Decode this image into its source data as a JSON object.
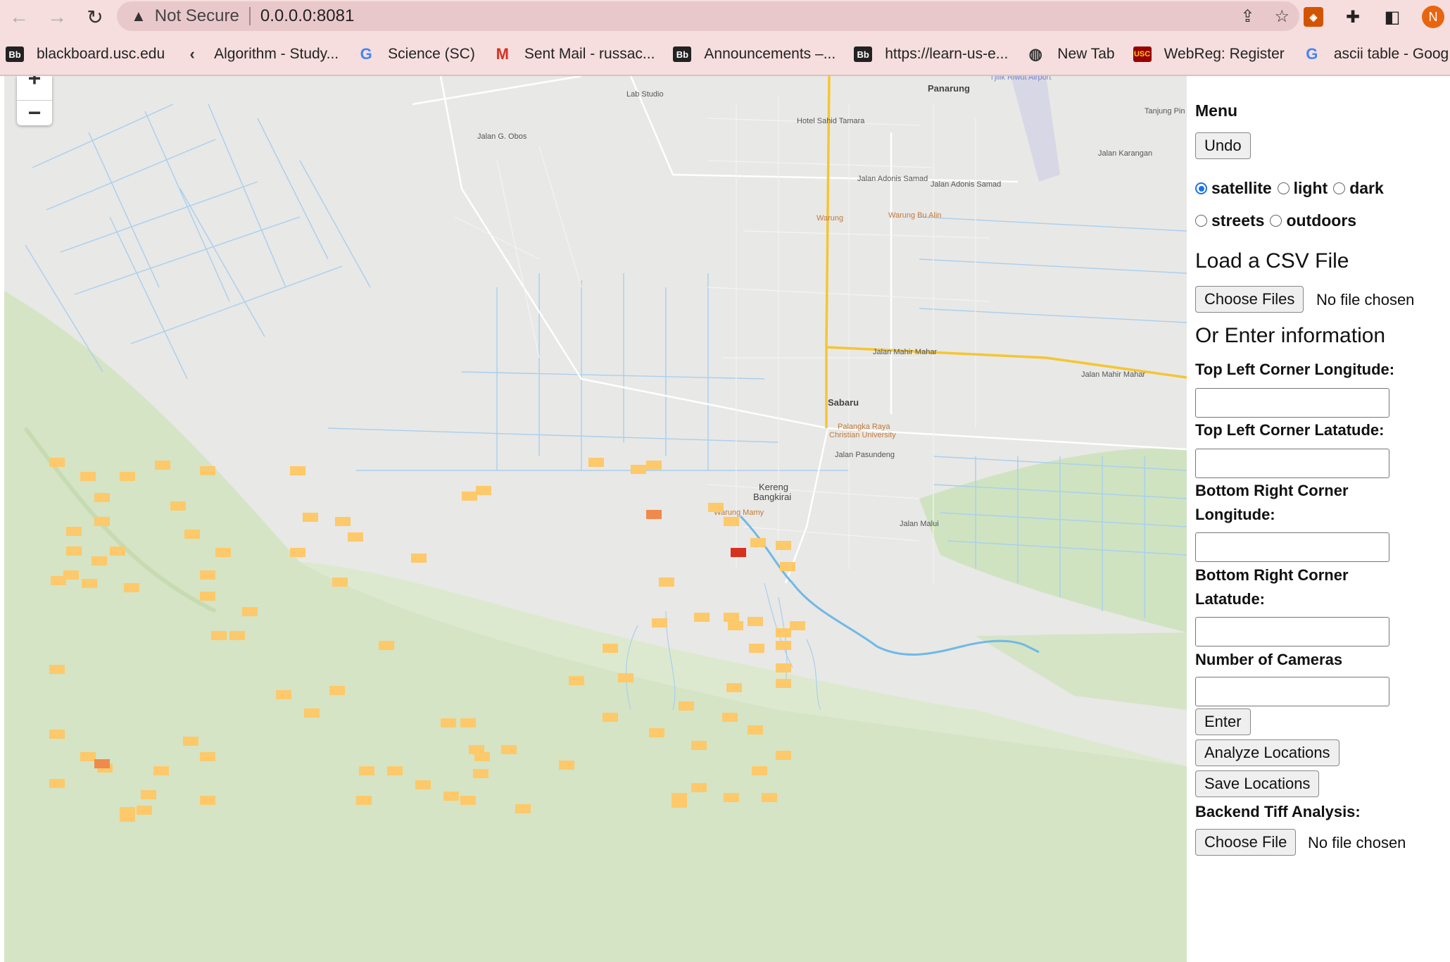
{
  "browser": {
    "back_icon": "arrow-left-icon",
    "forward_icon": "arrow-right-icon",
    "reload_icon": "reload-icon",
    "security_label": "Not Secure",
    "url": "0.0.0.0:8081",
    "avatar_initial": "N"
  },
  "bookmarks": [
    {
      "label": "blackboard.usc.edu",
      "icon": "blackboard-icon"
    },
    {
      "label": "Algorithm - Study...",
      "icon": "algorithm-icon"
    },
    {
      "label": "Science (SC)",
      "icon": "google-icon"
    },
    {
      "label": "Sent Mail - russac...",
      "icon": "gmail-icon"
    },
    {
      "label": "Announcements –...",
      "icon": "blackboard-icon"
    },
    {
      "label": "https://learn-us-e...",
      "icon": "blackboard-icon"
    },
    {
      "label": "New Tab",
      "icon": "globe-icon"
    },
    {
      "label": "WebReg: Register",
      "icon": "usc-icon"
    },
    {
      "label": "ascii table - Goog",
      "icon": "google-icon"
    }
  ],
  "map": {
    "zoom_in": "+",
    "zoom_out": "−",
    "labels": {
      "panarung": "Panarung",
      "tanjung": "Tanjung Pin",
      "airport": "Tjilik Riwut Airport",
      "lab_studio": "Lab Studio",
      "hotel": "Hotel Sahid Tamara",
      "adonis1": "Jalan Adonis Samad",
      "adonis2": "Jalan Adonis Samad",
      "warung": "Warung",
      "warung_bu_alin": "Warung Bu Alin",
      "sabaru": "Sabaru",
      "palangka": "Palangka Raya",
      "christian": "Christian University",
      "mahir1": "Jalan Mahir Mahar",
      "mahir2": "Jalan Mahir Mahar",
      "kereng1": "Kereng",
      "kereng2": "Bangkirai",
      "warung_mamy": "Warung Mamy",
      "pasundeng": "Jalan Pasundeng",
      "obos": "Jalan G. Obos",
      "karangan": "Jalan Karangan",
      "malui": "Jalan Malui"
    },
    "heat_colors": {
      "low": "#fdc96a",
      "mid": "#f08a4b",
      "high": "#d7301f"
    }
  },
  "menu": {
    "title": "Menu",
    "undo": "Undo",
    "styles": [
      {
        "label": "satellite",
        "checked": true
      },
      {
        "label": "light",
        "checked": false
      },
      {
        "label": "dark",
        "checked": false
      },
      {
        "label": "streets",
        "checked": false
      },
      {
        "label": "outdoors",
        "checked": false
      }
    ],
    "load_csv_heading": "Load a CSV File",
    "choose_files": "Choose Files",
    "no_file": "No file chosen",
    "enter_info_heading": "Or Enter information",
    "tl_lon": "Top Left Corner Longitude:",
    "tl_lat": "Top Left Corner Latatude:",
    "br_lon": "Bottom Right Corner Longitude:",
    "br_lat": "Bottom Right Corner Latatude:",
    "num_cameras": "Number of Cameras",
    "enter": "Enter",
    "analyze": "Analyze Locations",
    "save": "Save Locations",
    "tiff_heading": "Backend Tiff Analysis:",
    "choose_file": "Choose File",
    "no_file_2": "No file chosen"
  }
}
